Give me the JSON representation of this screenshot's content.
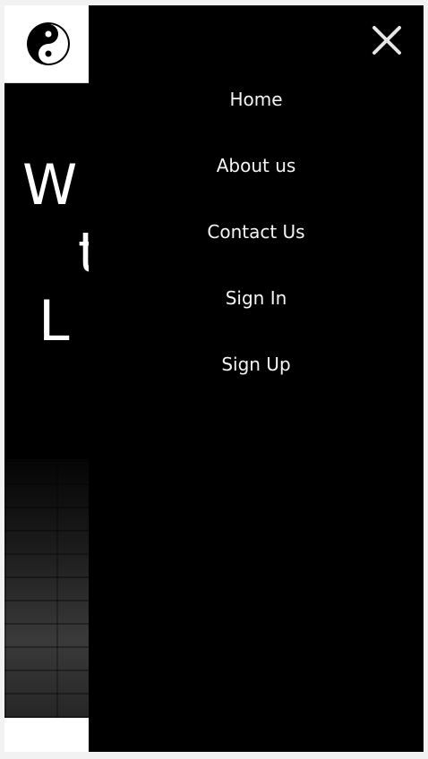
{
  "header": {
    "logo_icon": "yin-yang-icon"
  },
  "hero": {
    "line1": "W",
    "line2": "t",
    "line3": "L"
  },
  "menu": {
    "close_icon": "close-icon",
    "items": [
      {
        "label": "Home"
      },
      {
        "label": "About us"
      },
      {
        "label": "Contact Us"
      },
      {
        "label": "Sign In"
      },
      {
        "label": "Sign Up"
      }
    ]
  },
  "colors": {
    "menu_background": "#000000",
    "menu_text": "#f5f5f5",
    "page_background": "#ffffff"
  }
}
